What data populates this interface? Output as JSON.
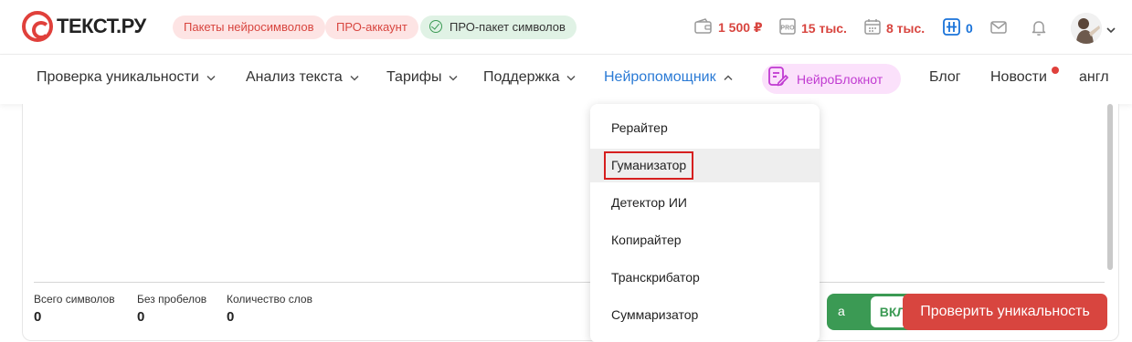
{
  "brand": {
    "logo_text": "ТЕКСТ.РУ"
  },
  "header": {
    "pills": {
      "neurosymbols": "Пакеты нейросимволов",
      "pro_account": "ПРО-аккаунт",
      "pro_package": "ПРО-пакет символов"
    },
    "stats": {
      "balance": "1 500 ₽",
      "pro_chars": "15 тыс.",
      "days": "8 тыс.",
      "counter": "0"
    },
    "icons": [
      "wallet-icon",
      "pro-icon",
      "calendar-icon",
      "grid-icon",
      "mail-icon",
      "bell-icon"
    ]
  },
  "nav": {
    "items": [
      {
        "label": "Проверка уникальности"
      },
      {
        "label": "Анализ текста"
      },
      {
        "label": "Тарифы"
      },
      {
        "label": "Поддержка"
      },
      {
        "label": "Нейропомощник"
      }
    ],
    "neuro_notebook": "НейроБлокнот",
    "blog": "Блог",
    "news": "Новости",
    "lang": "англ"
  },
  "dropdown": {
    "items": [
      {
        "label": "Рерайтер"
      },
      {
        "label": "Гуманизатор"
      },
      {
        "label": "Детектор ИИ"
      },
      {
        "label": "Копирайтер"
      },
      {
        "label": "Транскрибатор"
      },
      {
        "label": "Суммаризатор"
      }
    ]
  },
  "counters": {
    "total": {
      "label": "Всего символов",
      "value": "0"
    },
    "no_spaces": {
      "label": "Без пробелов",
      "value": "0"
    },
    "words": {
      "label": "Количество слов",
      "value": "0"
    }
  },
  "actions": {
    "toggle_fragment": "а",
    "toggle_state": "ВКЛ",
    "check_button": "Проверить уникальность"
  },
  "colors": {
    "brand_red": "#d8453f",
    "accent_blue": "#2a7ad5",
    "green": "#3b9a54",
    "highlight": "#d61f1f"
  }
}
